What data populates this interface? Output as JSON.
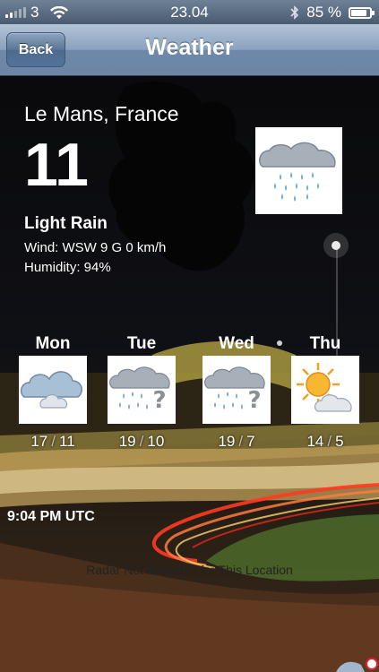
{
  "status": {
    "carrier": "3",
    "time": "23.04",
    "battery": "85 %",
    "battery_level": 0.85
  },
  "nav": {
    "back_label": "Back",
    "title": "Weather"
  },
  "current": {
    "location": "Le Mans, France",
    "temperature": "11",
    "condition": "Light Rain",
    "wind": "Wind: WSW 9  G  0 km/h",
    "humidity": "Humidity: 94%",
    "icon": "rain-cloud-icon"
  },
  "forecast": [
    {
      "day": "Mon",
      "high": "17",
      "low": "11",
      "icon": "cloudy-icon"
    },
    {
      "day": "Tue",
      "high": "19",
      "low": "10",
      "icon": "rain-uncertain-icon"
    },
    {
      "day": "Wed",
      "high": "19",
      "low": "7",
      "icon": "rain-uncertain-icon"
    },
    {
      "day": "Thu",
      "high": "14",
      "low": "5",
      "icon": "partly-sunny-icon"
    }
  ],
  "webcam": {
    "timestamp": "9:04 PM UTC",
    "radar_message": "Radar Not Available for This Location"
  }
}
